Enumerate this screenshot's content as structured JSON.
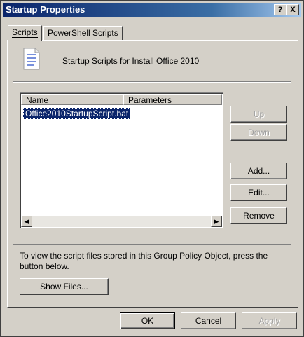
{
  "window": {
    "title": "Startup Properties"
  },
  "titlebar_buttons": {
    "help": "?",
    "close": "X"
  },
  "tabs": [
    {
      "label": "Scripts",
      "active": true
    },
    {
      "label": "PowerShell Scripts",
      "active": false
    }
  ],
  "header": {
    "text": "Startup Scripts for Install Office 2010",
    "icon": "script-file-icon"
  },
  "list": {
    "columns": [
      "Name",
      "Parameters"
    ],
    "rows": [
      {
        "name": "Office2010StartupScript.bat",
        "parameters": "",
        "selected": true
      }
    ]
  },
  "side_buttons": {
    "up": "Up",
    "down": "Down",
    "add": "Add...",
    "edit": "Edit...",
    "remove": "Remove"
  },
  "info_text": "To view the script files stored in this Group Policy Object, press the button below.",
  "show_files_label": "Show Files...",
  "footer": {
    "ok": "OK",
    "cancel": "Cancel",
    "apply": "Apply"
  },
  "colors": {
    "title_start": "#0a246a",
    "title_end": "#a6caf0",
    "selection": "#0a246a",
    "face": "#d4d0c8"
  }
}
